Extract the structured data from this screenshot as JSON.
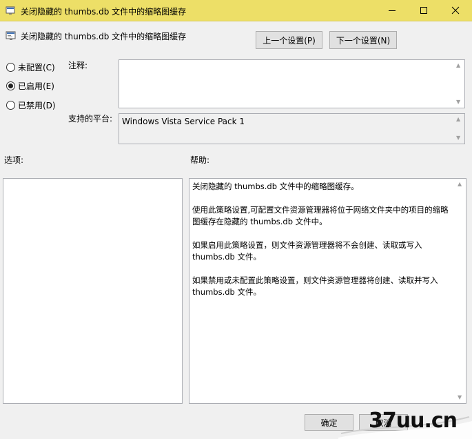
{
  "window": {
    "title": "关闭隐藏的 thumbs.db 文件中的缩略图缓存",
    "controls": {
      "minimize": "minimize-icon",
      "maximize": "maximize-icon",
      "close": "close-icon"
    }
  },
  "header": {
    "policy_name": "关闭隐藏的 thumbs.db 文件中的缩略图缓存",
    "prev_button": "上一个设置(P)",
    "next_button": "下一个设置(N)"
  },
  "state": {
    "options": [
      {
        "label": "未配置(C)",
        "checked": false
      },
      {
        "label": "已启用(E)",
        "checked": true
      },
      {
        "label": "已禁用(D)",
        "checked": false
      }
    ]
  },
  "comment": {
    "label": "注释:",
    "value": ""
  },
  "platform": {
    "label": "支持的平台:",
    "value": "Windows Vista Service Pack 1"
  },
  "options_section": {
    "label": "选项:"
  },
  "help_section": {
    "label": "帮助:",
    "paragraphs": [
      "关闭隐藏的 thumbs.db 文件中的缩略图缓存。",
      "使用此策略设置,可配置文件资源管理器将位于网络文件夹中的项目的缩略图缓存在隐藏的 thumbs.db 文件中。",
      "如果启用此策略设置，则文件资源管理器将不会创建、读取或写入 thumbs.db 文件。",
      "如果禁用或未配置此策略设置，则文件资源管理器将创建、读取并写入 thumbs.db 文件。"
    ]
  },
  "footer": {
    "ok_button": "确定",
    "cancel_button": "取消"
  },
  "watermark": {
    "text": "37uu.cn"
  },
  "colors": {
    "titlebar": "#eddf67",
    "focus_border": "#0078d7",
    "window_bg": "#f0f0f0"
  }
}
